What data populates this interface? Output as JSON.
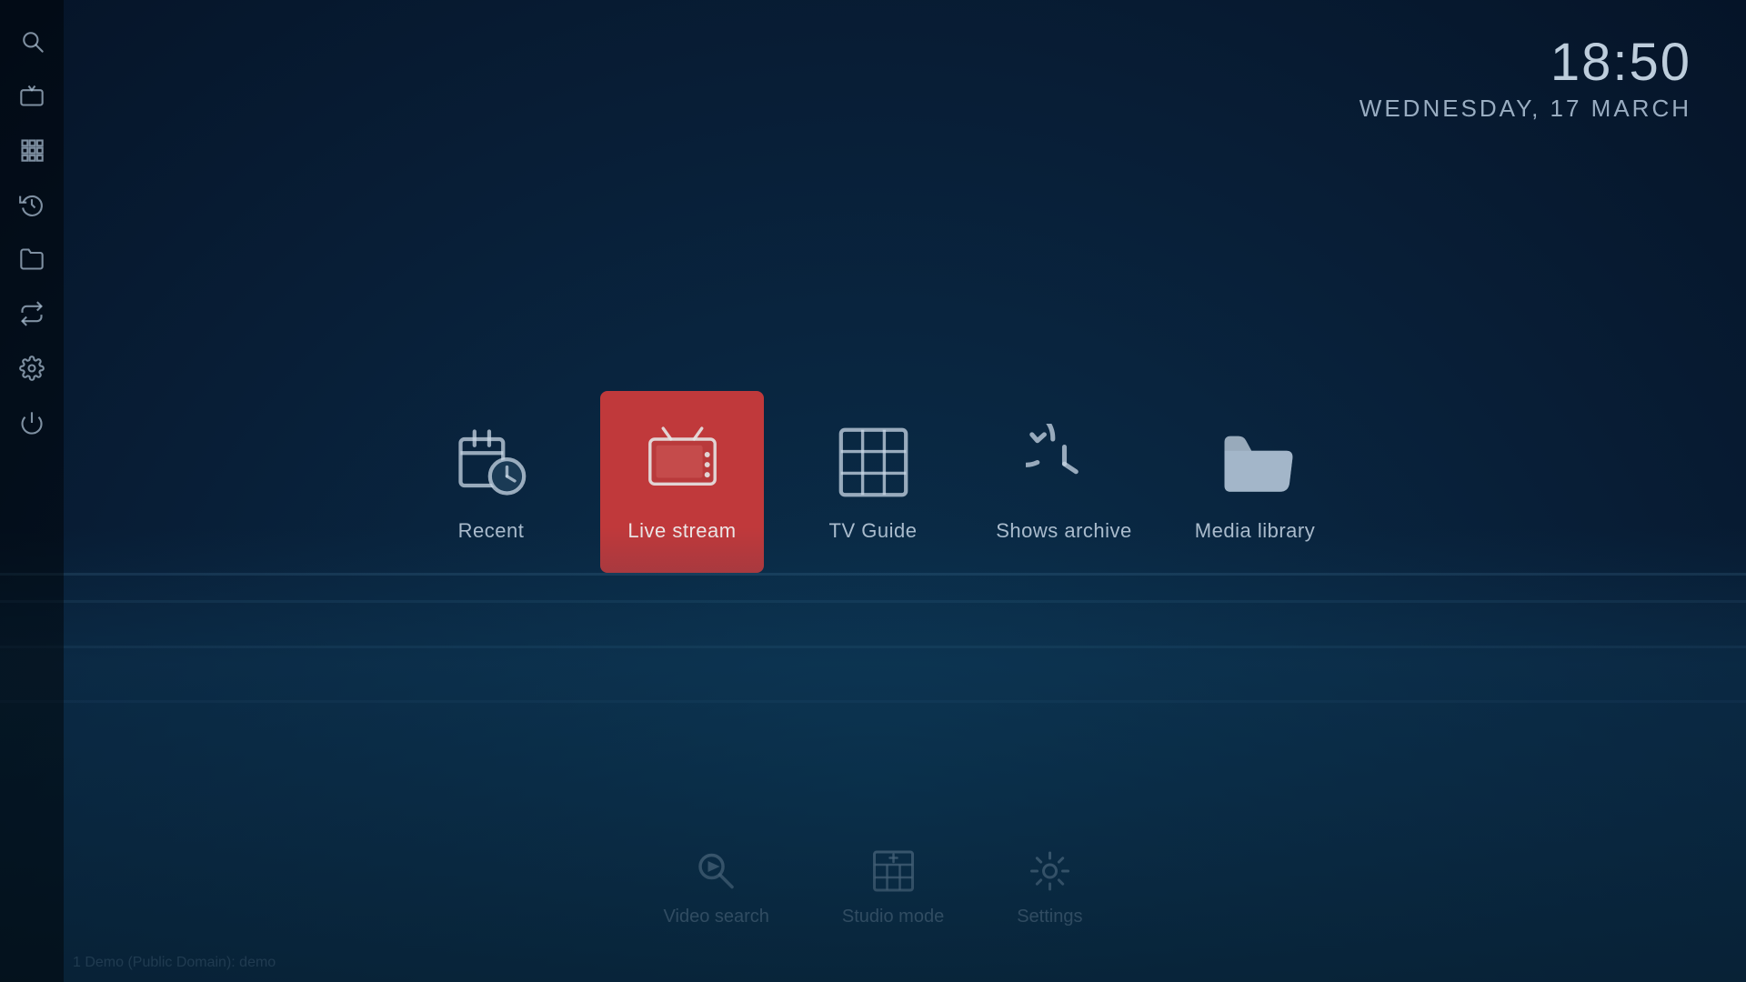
{
  "background": {
    "color": "#0d2a3e"
  },
  "clock": {
    "time": "18:50",
    "date": "Wednesday, 17 March"
  },
  "sidebar": {
    "items": [
      {
        "id": "search",
        "label": "Search",
        "icon": "search"
      },
      {
        "id": "tv",
        "label": "TV",
        "icon": "tv"
      },
      {
        "id": "grid",
        "label": "Grid",
        "icon": "grid"
      },
      {
        "id": "recent",
        "label": "Recent",
        "icon": "recent"
      },
      {
        "id": "folder",
        "label": "Folder",
        "icon": "folder"
      },
      {
        "id": "switch",
        "label": "Switch",
        "icon": "switch"
      },
      {
        "id": "settings",
        "label": "Settings",
        "icon": "settings"
      },
      {
        "id": "power",
        "label": "Power",
        "icon": "power"
      }
    ]
  },
  "menu": {
    "items": [
      {
        "id": "recent",
        "label": "Recent",
        "active": false
      },
      {
        "id": "live-stream",
        "label": "Live stream",
        "active": true
      },
      {
        "id": "tv-guide",
        "label": "TV Guide",
        "active": false
      },
      {
        "id": "shows-archive",
        "label": "Shows archive",
        "active": false
      },
      {
        "id": "media-library",
        "label": "Media library",
        "active": false
      }
    ]
  },
  "bottom_bar": {
    "items": [
      {
        "id": "video-search",
        "label": "Video search"
      },
      {
        "id": "studio-mode",
        "label": "Studio mode"
      },
      {
        "id": "settings",
        "label": "Settings"
      }
    ]
  },
  "status": {
    "text": "1 Demo (Public Domain): demo"
  },
  "colors": {
    "active": "#c0393b",
    "icon": "rgba(200,215,230,0.75)",
    "text": "rgba(200,215,230,0.85)"
  }
}
